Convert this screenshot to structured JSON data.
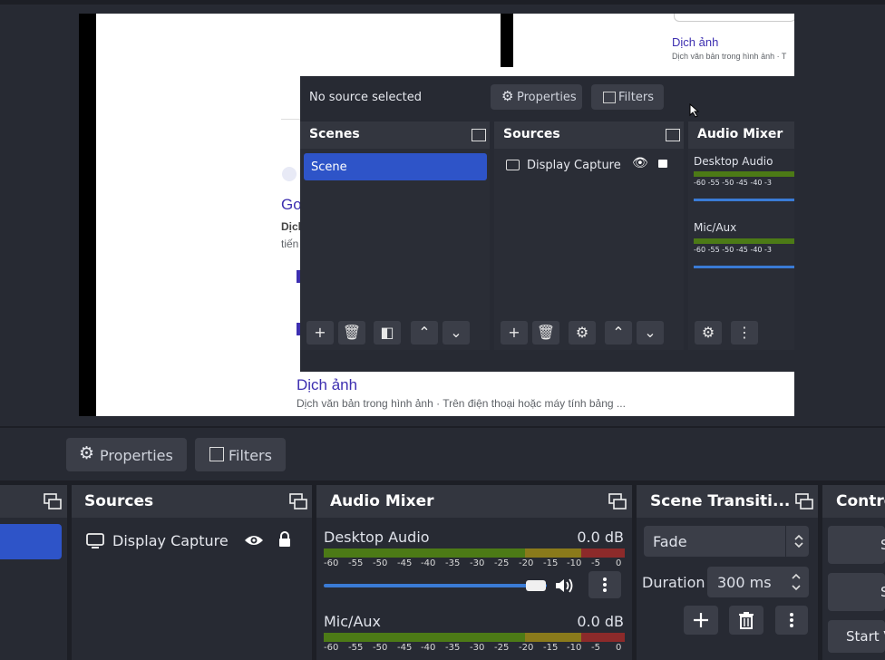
{
  "preview": {
    "web": {
      "top_link": "Dịch ảnh",
      "top_sub": "Dịch văn bản trong hình ảnh · T",
      "g_fragment": "Go",
      "dich_fragment": "Dịch",
      "tien_fragment": "tiến",
      "bottom_link": "Dịch ảnh",
      "bottom_sub": "Dịch văn bản trong hình ảnh · Trên điện thoại hoặc máy tính bảng ..."
    },
    "nested": {
      "no_source": "No source selected",
      "properties_label": "Properties",
      "filters_label": "Filters",
      "scenes_title": "Scenes",
      "scene_item": "Scene",
      "sources_title": "Sources",
      "source_item": "Display Capture",
      "mixer_title": "Audio Mixer",
      "desktop_audio": "Desktop Audio",
      "mic_aux": "Mic/Aux",
      "ticks": [
        "-60",
        "-55",
        "-50",
        "-45",
        "-40",
        "-3"
      ]
    }
  },
  "toolbar": {
    "properties_label": "Properties",
    "filters_label": "Filters"
  },
  "sources": {
    "title": "Sources",
    "items": [
      {
        "label": "Display Capture"
      }
    ]
  },
  "mixer": {
    "title": "Audio Mixer",
    "channels": [
      {
        "name": "Desktop Audio",
        "db": "0.0 dB",
        "volume": 1.0
      },
      {
        "name": "Mic/Aux",
        "db": "0.0 dB"
      }
    ],
    "ticks": [
      "-60",
      "-55",
      "-50",
      "-45",
      "-40",
      "-35",
      "-30",
      "-25",
      "-20",
      "-15",
      "-10",
      "-5",
      "0"
    ]
  },
  "transitions": {
    "title": "Scene Transiti...",
    "selected": "Fade",
    "duration_label": "Duration",
    "duration_value": "300 ms"
  },
  "controls": {
    "title": "Contro",
    "btn1": "S",
    "btn2": "S",
    "btn3": "Start V"
  },
  "colors": {
    "accent": "#2e54c8",
    "panel": "#272a33",
    "header": "#33363f"
  }
}
